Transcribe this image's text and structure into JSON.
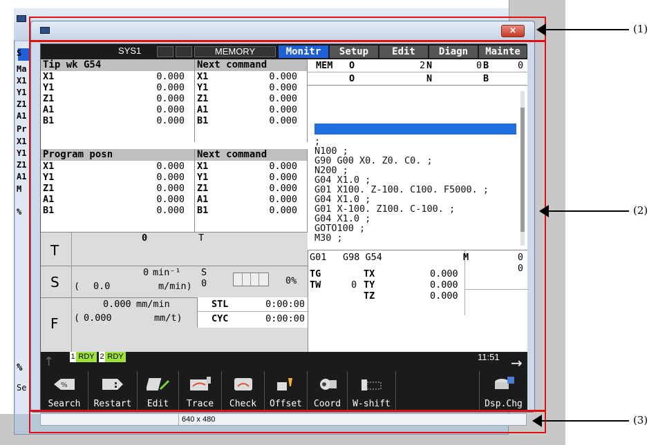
{
  "background_window": {
    "side_labels": [
      "S",
      "Ma",
      "X1",
      "Y1",
      "Z1",
      "A1",
      "Pr",
      "X1",
      "Y1",
      "Z1",
      "A1",
      "M",
      "%"
    ],
    "bottom_labels": [
      "%",
      "Se"
    ]
  },
  "window": {
    "close_icon": "×"
  },
  "topbar": {
    "system": "SYS1",
    "mode": "MEMORY",
    "tabs": [
      "Monitr",
      "Setup",
      "Edit",
      "Diagn",
      "Mainte"
    ]
  },
  "tip_wk": {
    "title": "Tip wk G54",
    "rows": [
      {
        "n": "X1",
        "v": "0.000"
      },
      {
        "n": "Y1",
        "v": "0.000"
      },
      {
        "n": "Z1",
        "v": "0.000"
      },
      {
        "n": "A1",
        "v": "0.000"
      },
      {
        "n": "B1",
        "v": "0.000"
      }
    ]
  },
  "next_cmd_1": {
    "title": "Next command",
    "rows": [
      {
        "n": "X1",
        "v": "0.000"
      },
      {
        "n": "Y1",
        "v": "0.000"
      },
      {
        "n": "Z1",
        "v": "0.000"
      },
      {
        "n": "A1",
        "v": "0.000"
      },
      {
        "n": "B1",
        "v": "0.000"
      }
    ]
  },
  "prog_posn": {
    "title": "Program posn",
    "rows": [
      {
        "n": "X1",
        "v": "0.000"
      },
      {
        "n": "Y1",
        "v": "0.000"
      },
      {
        "n": "Z1",
        "v": "0.000"
      },
      {
        "n": "A1",
        "v": "0.000"
      },
      {
        "n": "B1",
        "v": "0.000"
      }
    ]
  },
  "next_cmd_2": {
    "title": "Next command",
    "rows": [
      {
        "n": "X1",
        "v": "0.000"
      },
      {
        "n": "Y1",
        "v": "0.000"
      },
      {
        "n": "Z1",
        "v": "0.000"
      },
      {
        "n": "A1",
        "v": "0.000"
      },
      {
        "n": "B1",
        "v": "0.000"
      }
    ]
  },
  "mem": {
    "label": "MEM",
    "o1": "O",
    "o1v": "2",
    "n1": "N",
    "n1v": "0",
    "b1": "B",
    "b1v": "0",
    "o2": "O",
    "n2": "N",
    "b2": "B"
  },
  "program": {
    "lines": [
      ";",
      "N100 ;",
      "G90 G00 X0. Z0. C0. ;",
      "N200 ;",
      "G04 X1.0 ;",
      "G01 X100. Z-100. C100. F5000. ;",
      "G04 X1.0 ;",
      "G01 X-100. Z100. C-100. ;",
      "G04 X1.0 ;",
      "GOTO100 ;",
      "M30 ;"
    ]
  },
  "t_panel": {
    "label": "T",
    "value": "0",
    "t2": "T"
  },
  "s_panel": {
    "label": "S",
    "rpm": "0",
    "unit": "min⁻¹",
    "paren_val": "0.0",
    "paren_unit": "m/min)",
    "open_paren": "(",
    "s2": "S",
    "s2v": "0",
    "pct": "0%"
  },
  "f_panel": {
    "label": "F",
    "val": "0.000",
    "unit": "mm/min",
    "paren_val": "0.000",
    "paren_unit": "mm/t)",
    "open_paren": "("
  },
  "times": {
    "stl": "STL",
    "stl_v": "0:00:00",
    "cyc": "CYC",
    "cyc_v": "0:00:00"
  },
  "modal": {
    "g1": "G01",
    "g2": "G98 G54",
    "m": "M",
    "mv1": "0",
    "mv2": "0",
    "tg": "TG",
    "tx": "TX",
    "txv": "0.000",
    "tw": "TW",
    "twv": "0",
    "ty": "TY",
    "tyv": "0.000",
    "tz": "TZ",
    "tzv": "0.000"
  },
  "status": {
    "rdy1_num": "1",
    "rdy1": "RDY",
    "rdy2_num": "2",
    "rdy2": "RDY",
    "time": "11:51"
  },
  "softkeys": [
    "Search",
    "Restart",
    "Edit",
    "Trace",
    "Check",
    "Offset",
    "Coord",
    "W-shift",
    "Dsp.Chg"
  ],
  "statusbar": {
    "resolution": "640 x 480"
  },
  "callouts": [
    "(1)",
    "(2)",
    "(3)"
  ]
}
